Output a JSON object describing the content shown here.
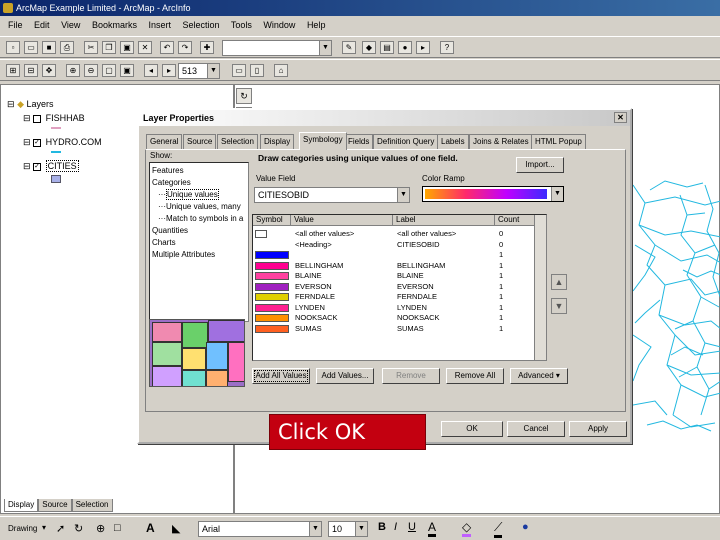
{
  "window": {
    "title": "ArcMap Example Limited - ArcMap - ArcInfo"
  },
  "menu": [
    "File",
    "Edit",
    "View",
    "Bookmarks",
    "Insert",
    "Selection",
    "Tools",
    "Window",
    "Help"
  ],
  "toolbar2": {
    "scale_value": "513"
  },
  "toc": {
    "root_label": "Layers",
    "layers": [
      {
        "name": "FISHHAB",
        "checked": false
      },
      {
        "name": "HYDRO.COM",
        "checked": true
      },
      {
        "name": "CITIES",
        "checked": true
      }
    ],
    "tabs": [
      "Display",
      "Source",
      "Selection"
    ]
  },
  "drawing_toolbar": {
    "drawing_label": "Drawing",
    "font": "Arial",
    "size": "10"
  },
  "dialog": {
    "title": "Layer Properties",
    "tabs": [
      "General",
      "Source",
      "Selection",
      "Display",
      "Symbology",
      "Fields",
      "Definition Query",
      "Labels",
      "Joins & Relates",
      "HTML Popup"
    ],
    "active_tab": "Symbology",
    "show_label": "Show:",
    "show_items": [
      {
        "label": "Features",
        "level": 0
      },
      {
        "label": "Categories",
        "level": 0
      },
      {
        "label": "Unique values",
        "level": 1,
        "selected": true
      },
      {
        "label": "Unique values, many",
        "level": 1
      },
      {
        "label": "Match to symbols in a",
        "level": 1
      },
      {
        "label": "Quantities",
        "level": 0
      },
      {
        "label": "Charts",
        "level": 0
      },
      {
        "label": "Multiple Attributes",
        "level": 0
      }
    ],
    "heading": "Draw categories using unique values of one field.",
    "import_button": "Import...",
    "value_field_label": "Value Field",
    "value_field": "CITIESOBID",
    "color_ramp_label": "Color Ramp",
    "grid_headers": [
      "Symbol",
      "Value",
      "Label",
      "Count"
    ],
    "rows": [
      {
        "color": "#ffffff",
        "value": "<all other values>",
        "label": "<all other values>",
        "count": "0"
      },
      {
        "color": "",
        "value": "<Heading>",
        "label": "CITIESOBID",
        "count": "0"
      },
      {
        "color": "#0000ff",
        "value": "",
        "label": "",
        "count": "1"
      },
      {
        "color": "#ff0090",
        "value": "BELLINGHAM",
        "label": "BELLINGHAM",
        "count": "1"
      },
      {
        "color": "#ff40a0",
        "value": "BLAINE",
        "label": "BLAINE",
        "count": "1"
      },
      {
        "color": "#a020c0",
        "value": "EVERSON",
        "label": "EVERSON",
        "count": "1"
      },
      {
        "color": "#e0d000",
        "value": "FERNDALE",
        "label": "FERNDALE",
        "count": "1"
      },
      {
        "color": "#ff2090",
        "value": "LYNDEN",
        "label": "LYNDEN",
        "count": "1"
      },
      {
        "color": "#ff9000",
        "value": "NOOKSACK",
        "label": "NOOKSACK",
        "count": "1"
      },
      {
        "color": "#ff6020",
        "value": "SUMAS",
        "label": "SUMAS",
        "count": "1"
      }
    ],
    "buttons": {
      "add_all": "Add All Values",
      "add": "Add Values...",
      "remove": "Remove",
      "remove_all": "Remove All",
      "advanced": "Advanced"
    },
    "footer": {
      "ok": "OK",
      "cancel": "Cancel",
      "apply": "Apply"
    }
  },
  "callout": {
    "text": "Click OK"
  }
}
